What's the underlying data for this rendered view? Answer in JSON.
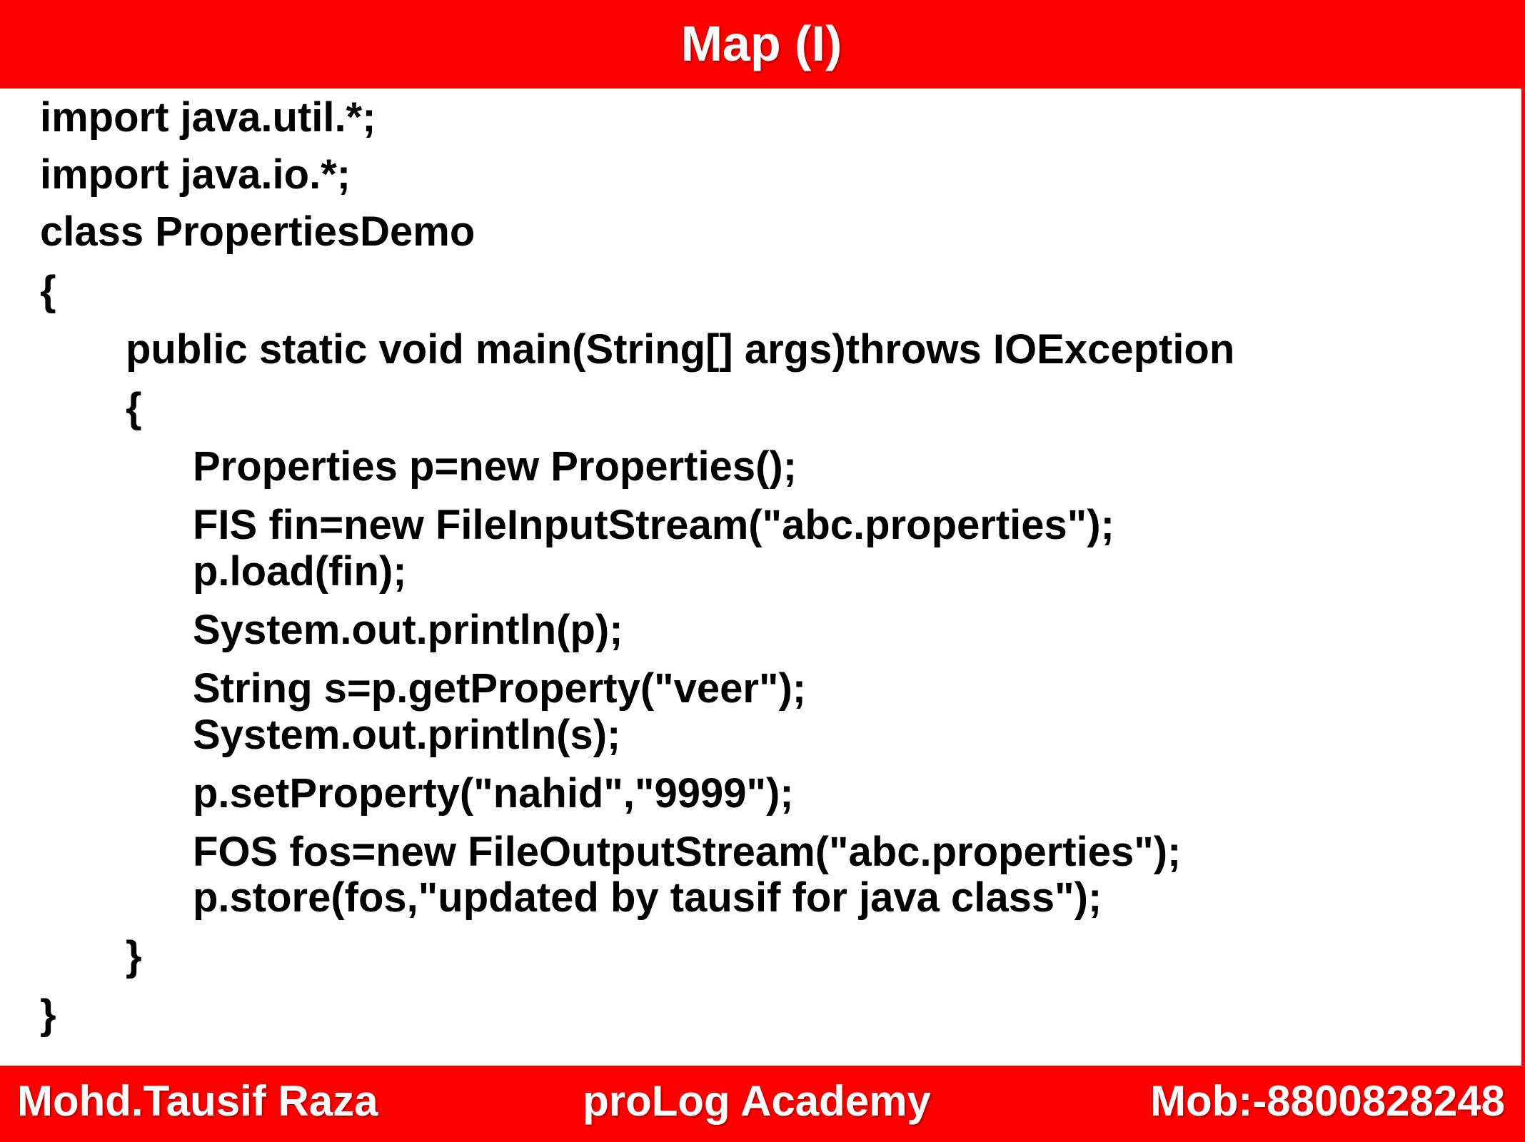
{
  "header": {
    "title": "Map (I)"
  },
  "code": {
    "lines": [
      "import java.util.*;",
      "import java.io.*;",
      "class PropertiesDemo",
      "{",
      "public static void main(String[] args)throws IOException",
      "{",
      "Properties p=new Properties();",
      "FIS fin=new FileInputStream(\"abc.properties\");",
      "p.load(fin);",
      "System.out.println(p);",
      "String s=p.getProperty(\"veer\");",
      "System.out.println(s);",
      "p.setProperty(\"nahid\",\"9999\");",
      "FOS fos=new FileOutputStream(\"abc.properties\");",
      "p.store(fos,\"updated by tausif for java class\");",
      "}",
      "}"
    ]
  },
  "footer": {
    "author": "Mohd.Tausif Raza",
    "academy": "proLog Academy",
    "mobile": "Mob:-8800828248"
  },
  "colors": {
    "banner": "#ff0000",
    "banner_text": "#ffffff",
    "code_text": "#000000"
  }
}
